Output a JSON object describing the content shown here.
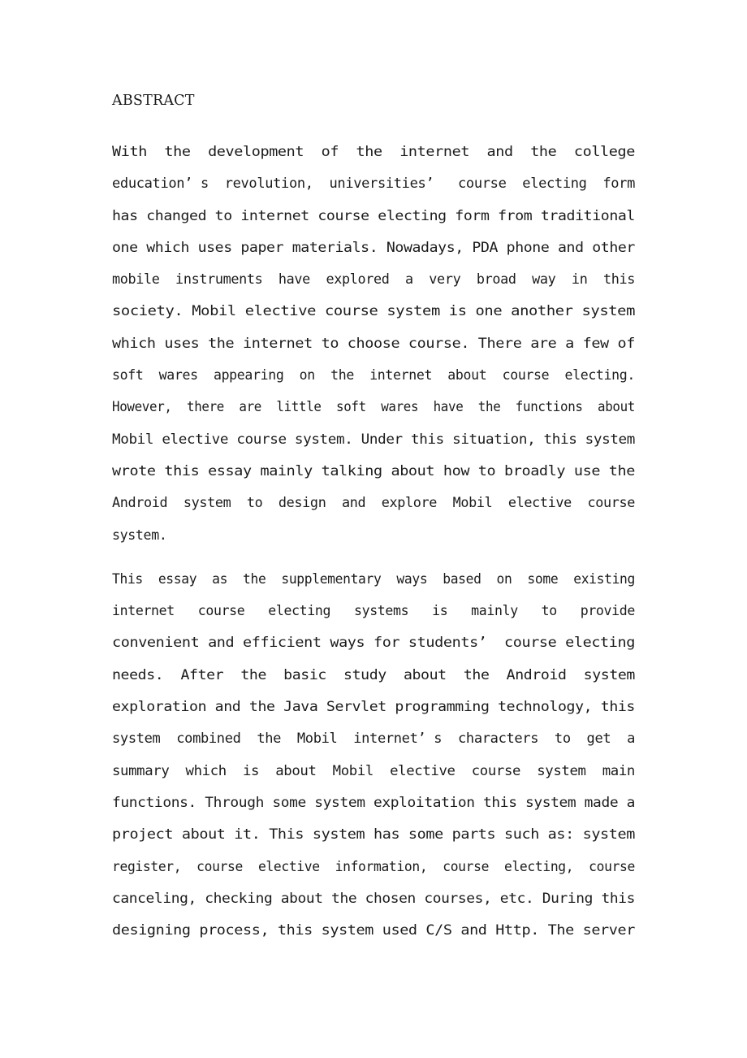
{
  "document": {
    "page_background": "#ffffff",
    "text_color": "#1c1c1c",
    "heading": "ABSTRACT",
    "paragraphs": [
      {
        "id": "abstract-para-1",
        "text": "With the development of the internet and the college education’ s revolution, universities’  course electing form has changed to internet course electing form from traditional one which uses paper materials. Nowadays, PDA phone and other mobile instruments have explored a very broad way in this society. Mobil elective course system is one another system which uses the internet to choose course. There are a few of soft wares appearing on the internet about course electing. However, there are little soft wares have the functions about Mobil elective course system. Under this situation, this system wrote this essay mainly talking about how to broadly use the Android system to design and explore Mobil elective course system.",
        "lines": [
          "With  the  development  of  the  internet  and  the  college",
          "education’ s  revolution,  universities’   course  electing  form",
          "has changed to internet course electing form from traditional",
          "one which uses paper materials. Nowadays, PDA phone and other",
          "mobile  instruments  have  explored  a  very  broad  way  in  this",
          "society. Mobil elective course system is one another system",
          "which uses the internet to choose course. There are a few of",
          "soft  wares  appearing  on  the  internet  about  course  electing.",
          "However,  there  are  little  soft  wares  have  the  functions  about",
          "Mobil elective course system. Under this situation, this system",
          "wrote this essay mainly talking about how to broadly use the",
          "Android  system  to  design  and  explore  Mobil  elective  course",
          "system."
        ]
      },
      {
        "id": "abstract-para-2",
        "text": "This essay as the supplementary ways based on some existing internet course electing systems is mainly to provide convenient and efficient ways for students’  course electing needs. After the basic study about the Android system exploration and the Java Servlet programming technology, this system combined the Mobil internet’ s characters to get a summary which is about Mobil elective course system main functions. Through some system exploitation this system made a project about it. This system has some parts such as: system register, course elective information, course electing, course canceling, checking about the chosen courses, etc. During this designing process, this system used C/S and Http. The server",
        "lines": [
          "This  essay  as  the  supplementary  ways  based  on  some  existing",
          "internet   course   electing   systems   is   mainly   to   provide",
          "convenient and efficient ways for students’  course electing",
          "needs.  After  the  basic  study  about  the  Android  system",
          "exploration and the Java Servlet programming technology, this",
          "system  combined  the  Mobil  internet’ s  characters  to  get  a",
          "summary  which  is  about  Mobil  elective  course  system  main",
          "functions. Through some system exploitation this system made a",
          "project about it. This system has some parts such as: system",
          "register,  course  elective  information,  course  electing,  course",
          "canceling, checking about the chosen courses, etc. During this",
          "designing process, this system used C/S and Http. The server"
        ]
      }
    ]
  }
}
